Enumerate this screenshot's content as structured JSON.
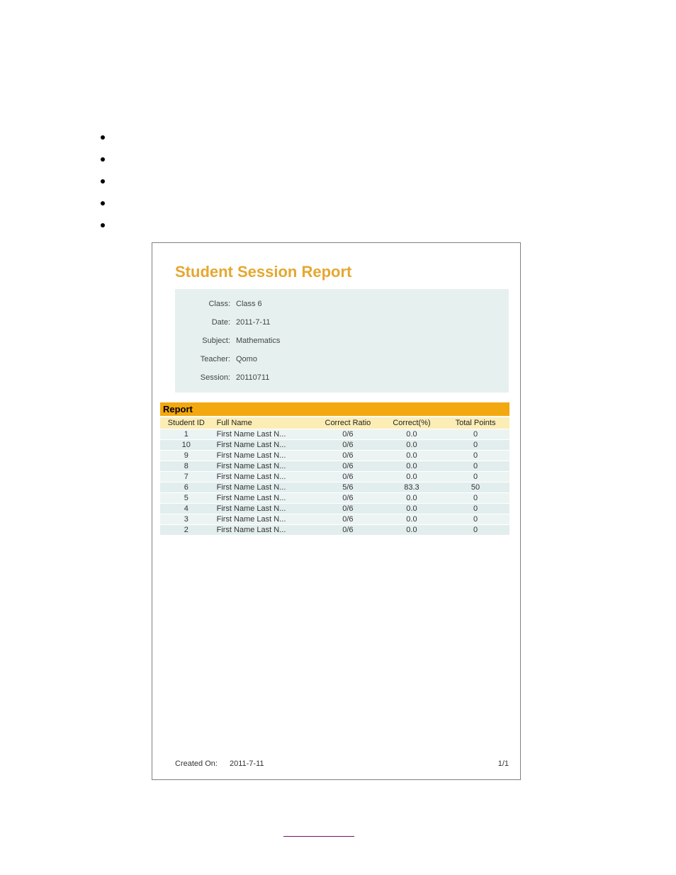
{
  "report": {
    "title": "Student Session Report",
    "section_header": "Report",
    "info": {
      "labels": {
        "class": "Class:",
        "date": "Date:",
        "subject": "Subject:",
        "teacher": "Teacher:",
        "session": "Session:"
      },
      "values": {
        "class": "Class 6",
        "date": "2011-7-11",
        "subject": "Mathematics",
        "teacher": "Qomo",
        "session": "20110711"
      }
    },
    "columns": {
      "student_id": "Student ID",
      "full_name": "Full Name",
      "correct_ratio": "Correct Ratio",
      "correct_pct": "Correct(%)",
      "total_points": "Total Points"
    },
    "rows": [
      {
        "id": "1",
        "name": "First Name Last N...",
        "ratio": "0/6",
        "pct": "0.0",
        "pts": "0"
      },
      {
        "id": "10",
        "name": "First Name Last N...",
        "ratio": "0/6",
        "pct": "0.0",
        "pts": "0"
      },
      {
        "id": "9",
        "name": "First Name Last N...",
        "ratio": "0/6",
        "pct": "0.0",
        "pts": "0"
      },
      {
        "id": "8",
        "name": "First Name Last N...",
        "ratio": "0/6",
        "pct": "0.0",
        "pts": "0"
      },
      {
        "id": "7",
        "name": "First Name Last N...",
        "ratio": "0/6",
        "pct": "0.0",
        "pts": "0"
      },
      {
        "id": "6",
        "name": "First Name Last N...",
        "ratio": "5/6",
        "pct": "83.3",
        "pts": "50"
      },
      {
        "id": "5",
        "name": "First Name Last N...",
        "ratio": "0/6",
        "pct": "0.0",
        "pts": "0"
      },
      {
        "id": "4",
        "name": "First Name Last N...",
        "ratio": "0/6",
        "pct": "0.0",
        "pts": "0"
      },
      {
        "id": "3",
        "name": "First Name Last N...",
        "ratio": "0/6",
        "pct": "0.0",
        "pts": "0"
      },
      {
        "id": "2",
        "name": "First Name Last N...",
        "ratio": "0/6",
        "pct": "0.0",
        "pts": "0"
      }
    ],
    "footer": {
      "created_label": "Created On:",
      "created_value": "2011-7-11",
      "page": "1/1"
    }
  }
}
